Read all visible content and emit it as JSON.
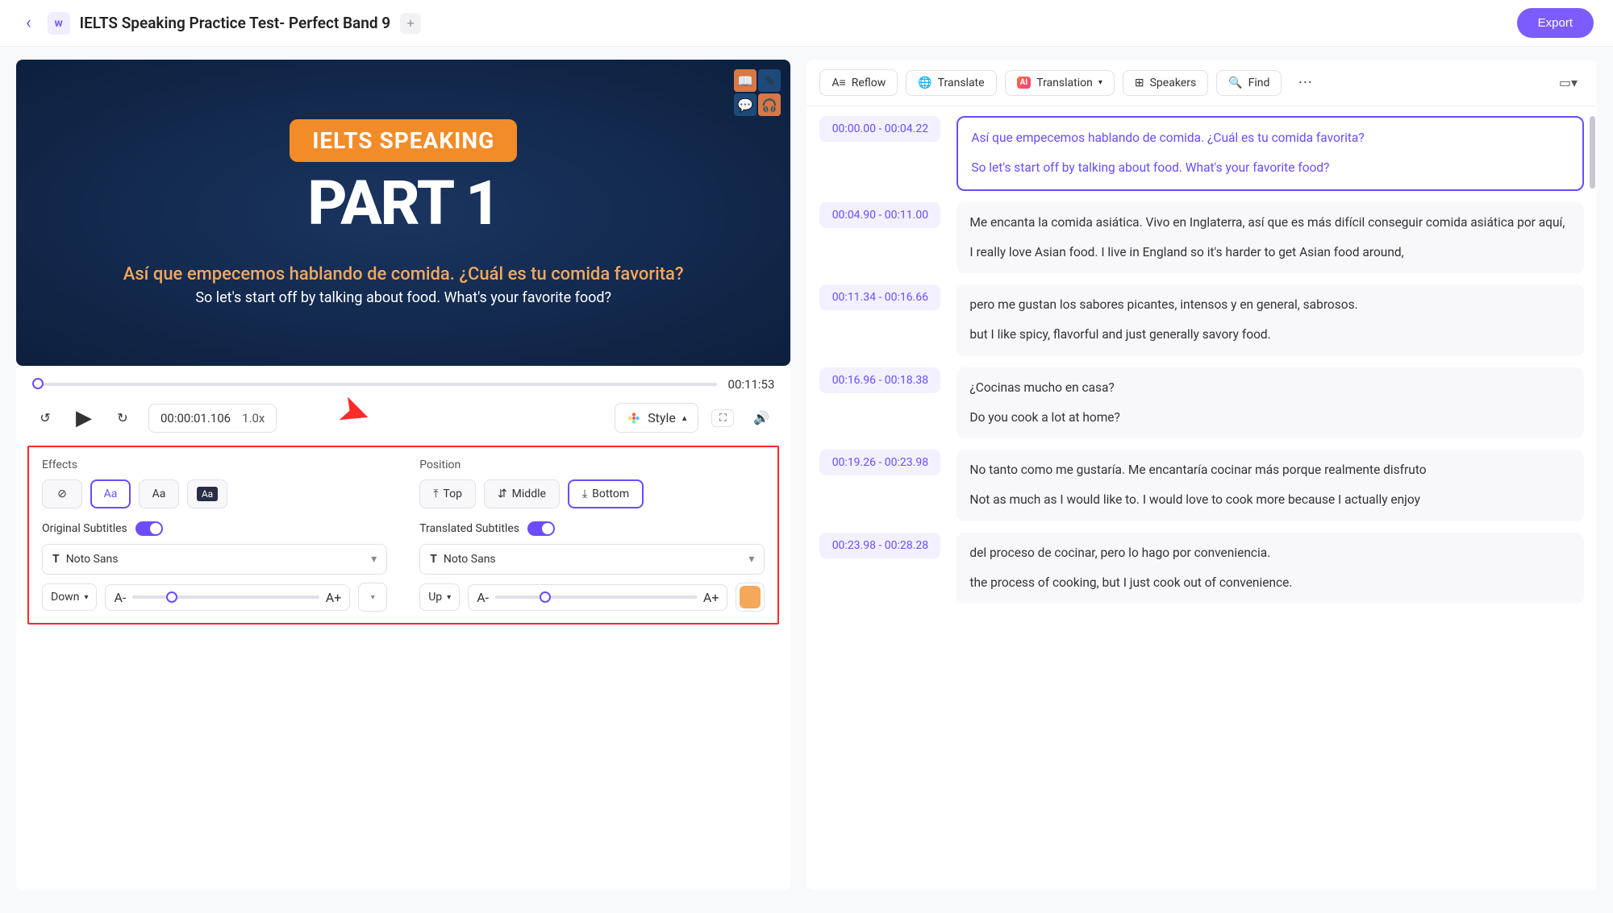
{
  "header": {
    "doc_title": "IELTS Speaking Practice Test- Perfect Band 9",
    "export_label": "Export"
  },
  "video": {
    "pill_text": "IELTS SPEAKING",
    "big_text": "PART 1",
    "sub_translated": "Así que empecemos hablando de comida. ¿Cuál es tu comida favorita?",
    "sub_original": "So let's start off by talking about food. What's your favorite food?",
    "total_time": "00:11:53",
    "current_time": "00:00:01.106",
    "speed": "1.0x",
    "style_label": "Style"
  },
  "style_panel": {
    "effects_label": "Effects",
    "position_label": "Position",
    "pos_top": "Top",
    "pos_middle": "Middle",
    "pos_bottom": "Bottom",
    "original_subs_label": "Original Subtitles",
    "translated_subs_label": "Translated Subtitles",
    "font_name": "Noto Sans",
    "dir_down": "Down",
    "dir_up": "Up",
    "size_minus": "A-",
    "size_plus": "A+",
    "swatch_color": "#f5a75a"
  },
  "toolbar": {
    "reflow": "Reflow",
    "translate": "Translate",
    "translation": "Translation",
    "speakers": "Speakers",
    "find": "Find"
  },
  "transcript": [
    {
      "time": "00:00.00 - 00:04.22",
      "translated": "Así que empecemos hablando de comida. ¿Cuál es tu comida favorita?",
      "original": "So let's start off by talking about food. What's your favorite food?",
      "selected": true
    },
    {
      "time": "00:04.90 - 00:11.00",
      "translated": "Me encanta la comida asiática. Vivo en Inglaterra, así que es más difícil conseguir comida asiática por aquí,",
      "original": "I really love Asian food. I live in England so it's harder to get Asian food around,"
    },
    {
      "time": "00:11.34 - 00:16.66",
      "translated": "pero me gustan los sabores picantes, intensos y en general, sabrosos.",
      "original": "but I like spicy, flavorful and just generally savory food."
    },
    {
      "time": "00:16.96 - 00:18.38",
      "translated": "¿Cocinas mucho en casa?",
      "original": "Do you cook a lot at home?"
    },
    {
      "time": "00:19.26 - 00:23.98",
      "translated": "No tanto como me gustaría. Me encantaría cocinar más porque realmente disfruto",
      "original": "Not as much as I would like to. I would love to cook more because I actually enjoy"
    },
    {
      "time": "00:23.98 - 00:28.28",
      "translated": "del proceso de cocinar, pero lo hago por conveniencia.",
      "original": "the process of cooking, but I just cook out of convenience."
    }
  ]
}
